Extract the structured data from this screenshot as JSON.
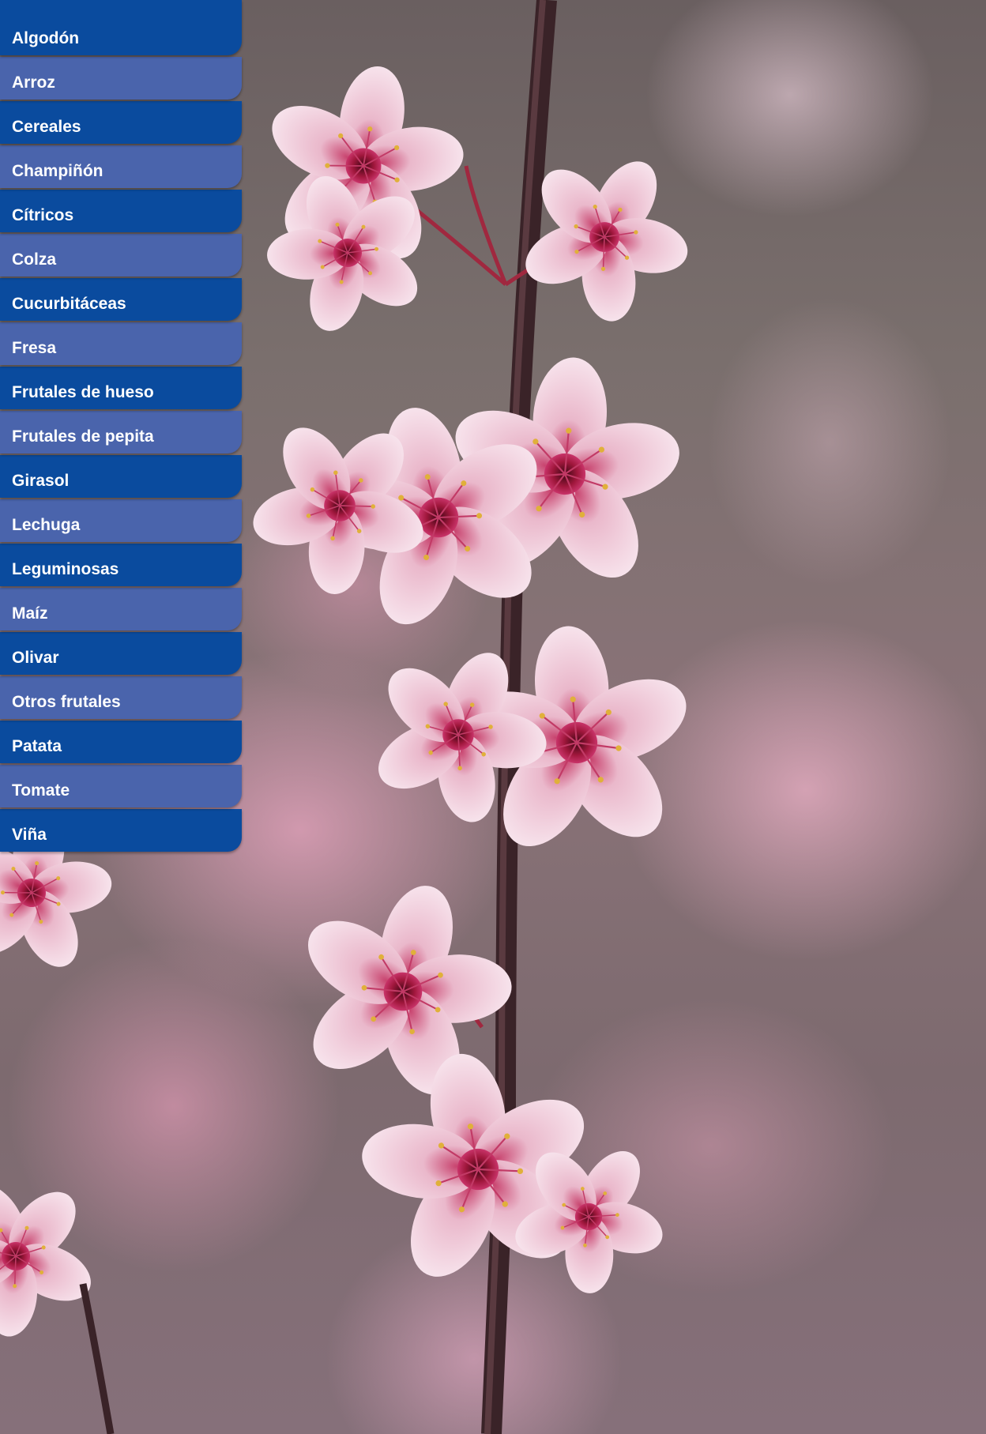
{
  "menu": {
    "items": [
      {
        "label": "Algodón",
        "style": "dark"
      },
      {
        "label": "Arroz",
        "style": "light"
      },
      {
        "label": "Cereales",
        "style": "dark"
      },
      {
        "label": "Champiñón",
        "style": "light"
      },
      {
        "label": "Cítricos",
        "style": "dark"
      },
      {
        "label": "Colza",
        "style": "light"
      },
      {
        "label": "Cucurbitáceas",
        "style": "dark"
      },
      {
        "label": "Fresa",
        "style": "light"
      },
      {
        "label": "Frutales de hueso",
        "style": "dark"
      },
      {
        "label": "Frutales de pepita",
        "style": "light"
      },
      {
        "label": "Girasol",
        "style": "dark"
      },
      {
        "label": "Lechuga",
        "style": "light"
      },
      {
        "label": "Leguminosas",
        "style": "dark"
      },
      {
        "label": "Maíz",
        "style": "light"
      },
      {
        "label": "Olivar",
        "style": "dark"
      },
      {
        "label": "Otros frutales",
        "style": "light"
      },
      {
        "label": "Patata",
        "style": "dark"
      },
      {
        "label": "Tomate",
        "style": "light"
      },
      {
        "label": "Viña",
        "style": "dark"
      }
    ]
  },
  "colors": {
    "menu_dark": "#0a4b9e",
    "menu_light": "#4a64ac",
    "menu_text": "#ffffff"
  },
  "background": {
    "icon": "cherry-blossom-branch-photo"
  }
}
